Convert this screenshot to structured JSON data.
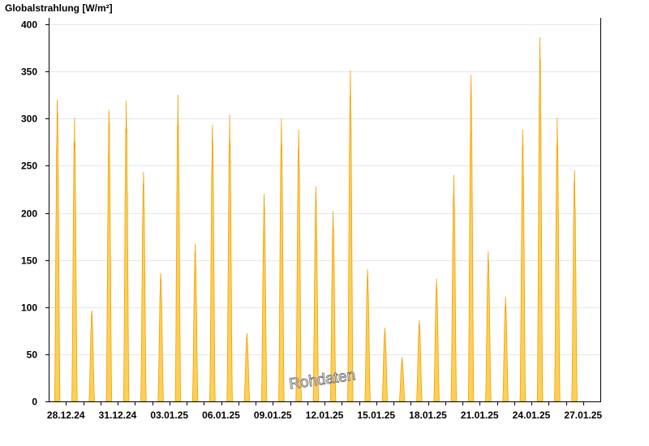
{
  "chart_data": {
    "type": "area",
    "title": "",
    "ylabel": "Globalstrahlung [W/m²]",
    "xlabel": "",
    "ylim": [
      0,
      400
    ],
    "y_ticks": [
      0,
      50,
      100,
      150,
      200,
      250,
      300,
      350,
      400
    ],
    "x_range": [
      "27.12.24",
      "28.01.25"
    ],
    "x_ticks": [
      "28.12.24",
      "31.12.24",
      "03.01.25",
      "06.01.25",
      "09.01.25",
      "12.01.25",
      "15.01.25",
      "18.01.25",
      "21.01.25",
      "24.01.25",
      "27.01.25"
    ],
    "grid": true,
    "series": [
      {
        "fill_color": "#ffcf57",
        "line_color": "#f0a000",
        "daily_peaks": [
          {
            "date": "27.12.24",
            "max": 320
          },
          {
            "date": "28.12.24",
            "max": 301
          },
          {
            "date": "29.12.24",
            "max": 96
          },
          {
            "date": "30.12.24",
            "max": 309
          },
          {
            "date": "31.12.24",
            "max": 319
          },
          {
            "date": "01.01.25",
            "max": 243
          },
          {
            "date": "02.01.25",
            "max": 136
          },
          {
            "date": "03.01.25",
            "max": 325
          },
          {
            "date": "04.01.25",
            "max": 167
          },
          {
            "date": "05.01.25",
            "max": 293
          },
          {
            "date": "06.01.25",
            "max": 304
          },
          {
            "date": "07.01.25",
            "max": 72
          },
          {
            "date": "08.01.25",
            "max": 220
          },
          {
            "date": "09.01.25",
            "max": 300
          },
          {
            "date": "10.01.25",
            "max": 288
          },
          {
            "date": "11.01.25",
            "max": 228
          },
          {
            "date": "12.01.25",
            "max": 202
          },
          {
            "date": "13.01.25",
            "max": 351
          },
          {
            "date": "14.01.25",
            "max": 140
          },
          {
            "date": "15.01.25",
            "max": 78
          },
          {
            "date": "16.01.25",
            "max": 47
          },
          {
            "date": "17.01.25",
            "max": 86
          },
          {
            "date": "18.01.25",
            "max": 130
          },
          {
            "date": "19.01.25",
            "max": 240
          },
          {
            "date": "20.01.25",
            "max": 346
          },
          {
            "date": "21.01.25",
            "max": 159
          },
          {
            "date": "22.01.25",
            "max": 111
          },
          {
            "date": "23.01.25",
            "max": 288
          },
          {
            "date": "24.01.25",
            "max": 386
          },
          {
            "date": "25.01.25",
            "max": 301
          },
          {
            "date": "26.01.25",
            "max": 245
          }
        ]
      }
    ],
    "watermark": "Rohdaten"
  }
}
